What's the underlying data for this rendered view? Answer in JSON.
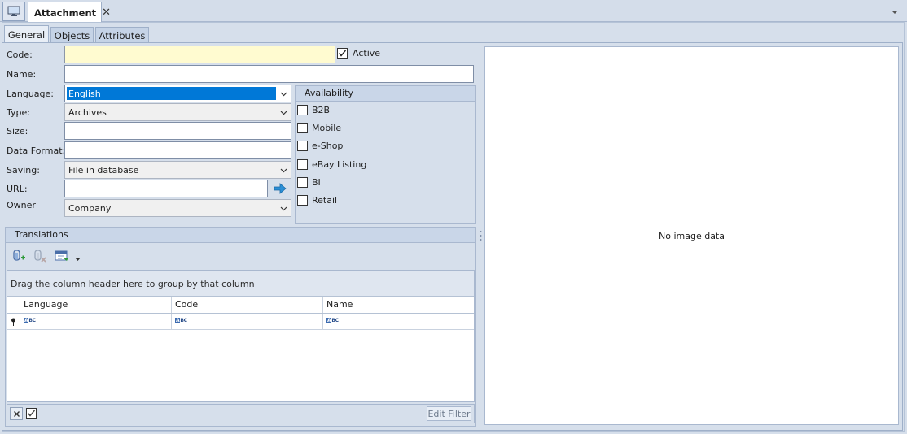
{
  "window": {
    "tab_title": "Attachment",
    "close_glyph": "✕"
  },
  "tabs": [
    "General",
    "Objects",
    "Attributes"
  ],
  "form": {
    "code_label": "Code:",
    "code_value": "",
    "active_label": "Active",
    "active_checked": true,
    "name_label": "Name:",
    "name_value": "",
    "language_label": "Language:",
    "language_value": "English",
    "type_label": "Type:",
    "type_value": "Archives",
    "size_label": "Size:",
    "size_value": "",
    "data_format_label": "Data Format:",
    "data_format_value": "",
    "saving_label": "Saving:",
    "saving_value": "File in database",
    "url_label": "URL:",
    "url_value": "",
    "owner_label": "Owner",
    "owner_value": "Company"
  },
  "availability": {
    "title": "Availability",
    "items": [
      {
        "label": "B2B",
        "checked": false
      },
      {
        "label": "Mobile",
        "checked": false
      },
      {
        "label": "e-Shop",
        "checked": false
      },
      {
        "label": "eBay Listing",
        "checked": false
      },
      {
        "label": "BI",
        "checked": false
      },
      {
        "label": "Retail",
        "checked": false
      }
    ]
  },
  "translations": {
    "title": "Translations",
    "group_hint": "Drag the column header here to group by that column",
    "columns": [
      "Language",
      "Code",
      "Name"
    ],
    "edit_filter_label": "Edit Filter"
  },
  "preview": {
    "empty_text": "No image data"
  },
  "colors": {
    "selection": "#0078d7",
    "required_field": "#fffbd0",
    "panel_bg": "#d6dfeb"
  }
}
